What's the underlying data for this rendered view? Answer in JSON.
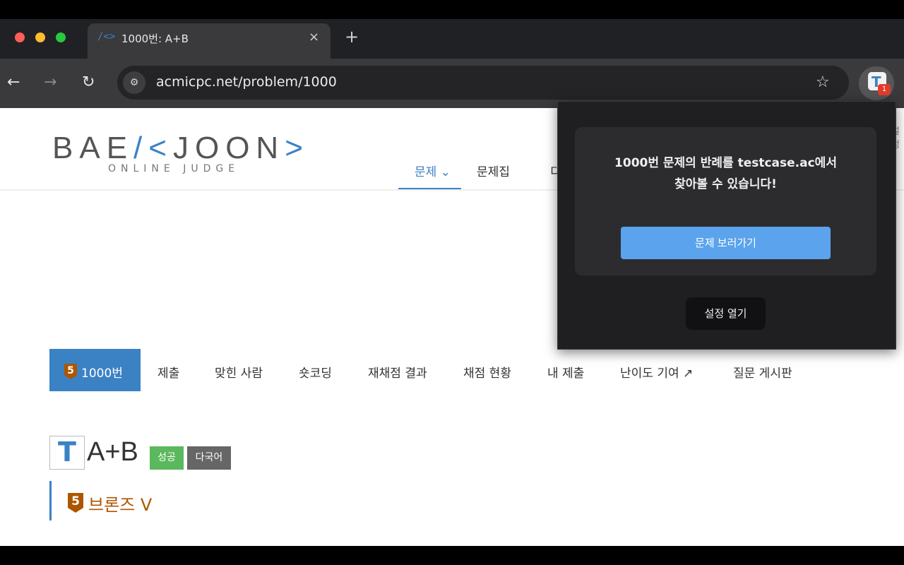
{
  "browser": {
    "tab_title": "1000번: A+B",
    "tab_favicon": "/<>",
    "new_tab": "+",
    "close_tab": "×",
    "url": "acmicpc.net/problem/1000",
    "back_icon": "←",
    "forward_icon": "→",
    "reload_icon": "↻",
    "site_info_icon": "⚙",
    "star_icon": "☆",
    "extension_letter": "T",
    "extension_badge": "1"
  },
  "site": {
    "logo_left": "BAE",
    "logo_mark": "/<",
    "logo_right": "JOON",
    "logo_end": ">",
    "logo_sub": "ONLINE JUDGE",
    "nav": [
      {
        "label": "문제 ⌄"
      },
      {
        "label": "문제집"
      },
      {
        "label": "디"
      }
    ],
    "right_stub": "설정"
  },
  "subnav": {
    "active_tier": "5",
    "active_label": "1000번",
    "items": [
      "제출",
      "맞힌 사람",
      "숏코딩",
      "재채점 결과",
      "채점 현황",
      "내 제출",
      "난이도 기여 ↗",
      "질문 게시판"
    ]
  },
  "problem": {
    "icon_letter": "T",
    "title": "A+B",
    "badge_success": "성공",
    "badge_multi": "다국어",
    "tier_number": "5",
    "tier_label": "브론즈 V"
  },
  "popup": {
    "message_line1": "1000번 문제의 반례를 testcase.ac에서",
    "message_line2": "찾아볼 수 있습니다!",
    "primary_button": "문제 보러가기",
    "settings_button": "설정 열기"
  },
  "colors": {
    "accent": "#3b82c4",
    "bronze": "#ad5600",
    "success": "#5cb85c",
    "popup_button": "#5ba3ec"
  }
}
